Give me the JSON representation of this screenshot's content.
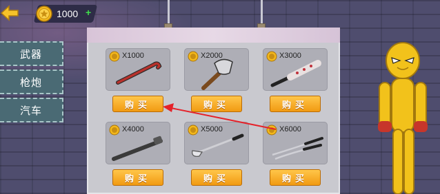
{
  "header": {
    "coins": "1000",
    "add_symbol": "+"
  },
  "tabs": [
    {
      "label": "武器"
    },
    {
      "label": "枪炮"
    },
    {
      "label": "汽车"
    }
  ],
  "items": [
    {
      "price": "X1000",
      "buy": "购买",
      "weapon_icon": "crowbar-icon"
    },
    {
      "price": "X2000",
      "buy": "购买",
      "weapon_icon": "axe-icon"
    },
    {
      "price": "X3000",
      "buy": "购买",
      "weapon_icon": "spiked-bat-icon"
    },
    {
      "price": "X4000",
      "buy": "购买",
      "weapon_icon": "wrench-bar-icon"
    },
    {
      "price": "X5000",
      "buy": "购买",
      "weapon_icon": "golf-club-icon"
    },
    {
      "price": "X6000",
      "buy": "购买",
      "weapon_icon": "twin-swords-icon"
    }
  ],
  "colors": {
    "buy_button": "#f5a623",
    "tab_bg": "#4a6a74",
    "annotation_arrow": "#e5222a"
  }
}
